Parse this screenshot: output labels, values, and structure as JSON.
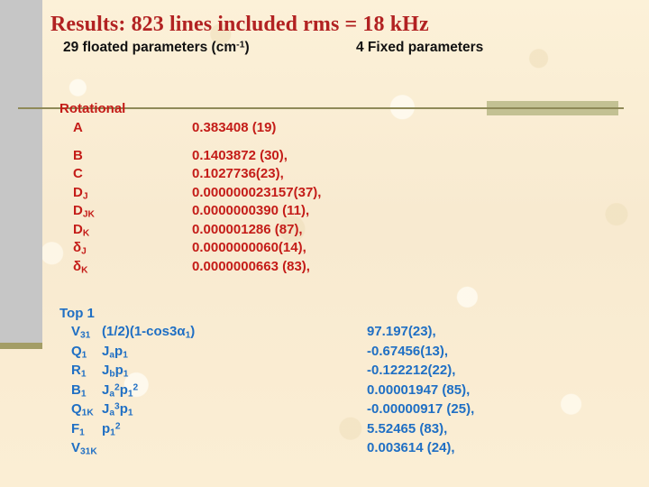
{
  "slide": {
    "title": "Results: 823 lines included rms = 18 kHz",
    "subtitle_left": "29 floated parameters (cm-1)",
    "subtitle_right": "4 Fixed parameters",
    "colors": {
      "background": "#faedcf",
      "title_red": "#b22222",
      "body_red": "#c41c18",
      "body_blue": "#1f6fc4",
      "band_grey": "#c6c6c6",
      "rule_olive": "#8f8a58",
      "block_olive": "#c3c193"
    }
  },
  "rotational": {
    "heading": "Rotational",
    "rows": [
      {
        "symbol": "A",
        "sub": "",
        "value": "0.383408 (19)"
      },
      {
        "symbol": "B",
        "sub": "",
        "value": "0.1403872  (30),"
      },
      {
        "symbol": "C",
        "sub": "",
        "value": "0.1027736(23),"
      },
      {
        "symbol": "D",
        "sub": "J",
        "value": "0.000000023157(37),"
      },
      {
        "symbol": "D",
        "sub": "JK",
        "value": "0.0000000390 (11),"
      },
      {
        "symbol": "D",
        "sub": "K",
        "value": "0.000001286 (87),"
      },
      {
        "symbol": "δ",
        "sub": "J",
        "value": "0.0000000060(14),"
      },
      {
        "symbol": "δ",
        "sub": "K",
        "value": "0.0000000663 (83),"
      }
    ]
  },
  "top1": {
    "heading": "Top 1",
    "rows": [
      {
        "symbol": "V",
        "sub": "31",
        "expr_html": "(1/2)(1-cos3α<sub>1</sub>)",
        "value": "97.197(23),"
      },
      {
        "symbol": "Q",
        "sub": "1",
        "expr_html": "J<sub>a</sub>p<sub>1</sub>",
        "value": "-0.67456(13),"
      },
      {
        "symbol": "R",
        "sub": "1",
        "expr_html": "J<sub>b</sub>p<sub>1</sub>",
        "value": "-0.122212(22),"
      },
      {
        "symbol": "B",
        "sub": "1",
        "expr_html": "J<sub>a</sub><sup>2</sup>p<sub>1</sub><sup>2</sup>",
        "value": "0.00001947 (85),"
      },
      {
        "symbol": "Q",
        "sub": "1K",
        "expr_html": "J<sub>a</sub><sup>3</sup>p<sub>1</sub>",
        "value": "-0.00000917 (25),"
      },
      {
        "symbol": "F",
        "sub": "1",
        "expr_html": "p<sub>1</sub><sup>2</sup>",
        "value": "5.52465 (83),"
      },
      {
        "symbol": "V",
        "sub": "31K",
        "expr_html": "",
        "value": "0.003614 (24),"
      }
    ]
  }
}
